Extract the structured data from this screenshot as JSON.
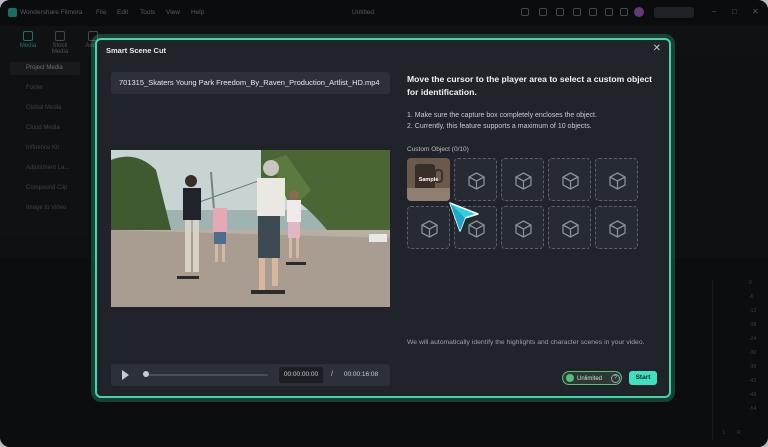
{
  "app": {
    "name": "Wondershare Filmora",
    "document_title": "Untitled",
    "menu": [
      "File",
      "Edit",
      "Tools",
      "View",
      "Help"
    ]
  },
  "toolbar": {
    "tabs": [
      "Media",
      "Stock Media",
      "Audio"
    ],
    "active_tab": "Media"
  },
  "sidebar": {
    "items": [
      "Project Media",
      "Folder",
      "Global Media",
      "Cloud Media",
      "Influence Kit",
      "Adjustment La...",
      "Compound Clip",
      "Image to Video"
    ],
    "selected": "Project Media"
  },
  "meter": {
    "scale": [
      "0",
      "-6",
      "-12",
      "-18",
      "-24",
      "-30",
      "-36",
      "-42",
      "-48",
      "-54"
    ],
    "channels": [
      "L",
      "R"
    ]
  },
  "dialog": {
    "title": "Smart Scene Cut",
    "file_name": "701315_Skaters Young Park Freedom_By_Raven_Production_Artlist_HD.mp4",
    "instruction_title": "Move the cursor to the player area to select a custom object for identification.",
    "tips": [
      "1. Make sure the capture box completely encloses the object.",
      "2. Currently, this feature supports a maximum of 10 objects."
    ],
    "custom_object_label": "Custom Object (0/10)",
    "sample_label": "Sample",
    "footer_text": "We will automatically identify the highlights and character scenes in your video.",
    "unlimited_label": "Unlimited",
    "help_glyph": "?",
    "start_label": "Start",
    "player": {
      "current_time": "00:00:00:00",
      "separator": "/",
      "total_time": "00:00:16:08",
      "progress": 0
    }
  },
  "colors": {
    "accent": "#3fd6a8",
    "start_button": "#3fe0c0",
    "dialog_bg": "#20232a"
  }
}
